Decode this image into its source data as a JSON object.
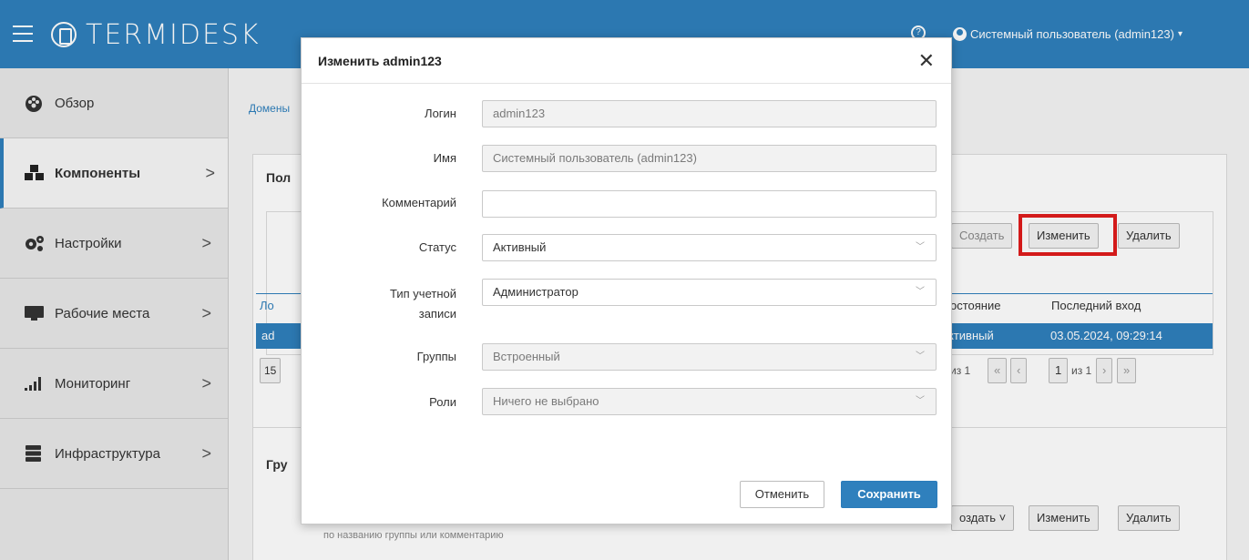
{
  "header": {
    "logo_text": "TERMIDESK",
    "help_icon": "question-circle-icon",
    "user_label": "Системный пользователь (admin123)"
  },
  "sidebar": {
    "items": [
      {
        "label": "Обзор",
        "icon": "dashboard-icon",
        "has_arrow": false
      },
      {
        "label": "Компоненты",
        "icon": "components-icon",
        "has_arrow": true,
        "active": true
      },
      {
        "label": "Настройки",
        "icon": "gears-icon",
        "has_arrow": true
      },
      {
        "label": "Рабочие места",
        "icon": "monitor-icon",
        "has_arrow": true
      },
      {
        "label": "Мониторинг",
        "icon": "bar-chart-icon",
        "has_arrow": true
      },
      {
        "label": "Инфраструктура",
        "icon": "server-icon",
        "has_arrow": true
      }
    ]
  },
  "main": {
    "breadcrumb": "Домены",
    "panel1": {
      "title": "Пол",
      "create": "Создать",
      "edit": "Изменить",
      "delete": "Удалить",
      "col_login": "Ло",
      "col_status": "остояние",
      "col_last": "Последний вход",
      "row_login": "ad",
      "row_status": "ктивный",
      "row_last": "03.05.2024, 09:29:14",
      "page_size": "15",
      "pager_left": "из 1",
      "pager_page": "1",
      "pager_total": "из 1"
    },
    "panel2": {
      "title": "Гру",
      "create": "оздать",
      "edit": "Изменить",
      "delete": "Удалить",
      "hint": "по названию группы или комментарию"
    }
  },
  "modal": {
    "title": "Изменить admin123",
    "fields": {
      "login_label": "Логин",
      "login_value": "admin123",
      "name_label": "Имя",
      "name_value": "Системный пользователь (admin123)",
      "comment_label": "Комментарий",
      "comment_value": "",
      "status_label": "Статус",
      "status_value": "Активный",
      "account_type_label_1": "Тип учетной",
      "account_type_label_2": "записи",
      "account_type_value": "Администратор",
      "groups_label": "Группы",
      "groups_value": "Встроенный",
      "roles_label": "Роли",
      "roles_value": "Ничего не выбрано"
    },
    "cancel_label": "Отменить",
    "save_label": "Сохранить"
  },
  "colors": {
    "header": "#2f80bd",
    "highlight": "#e11c1c"
  }
}
